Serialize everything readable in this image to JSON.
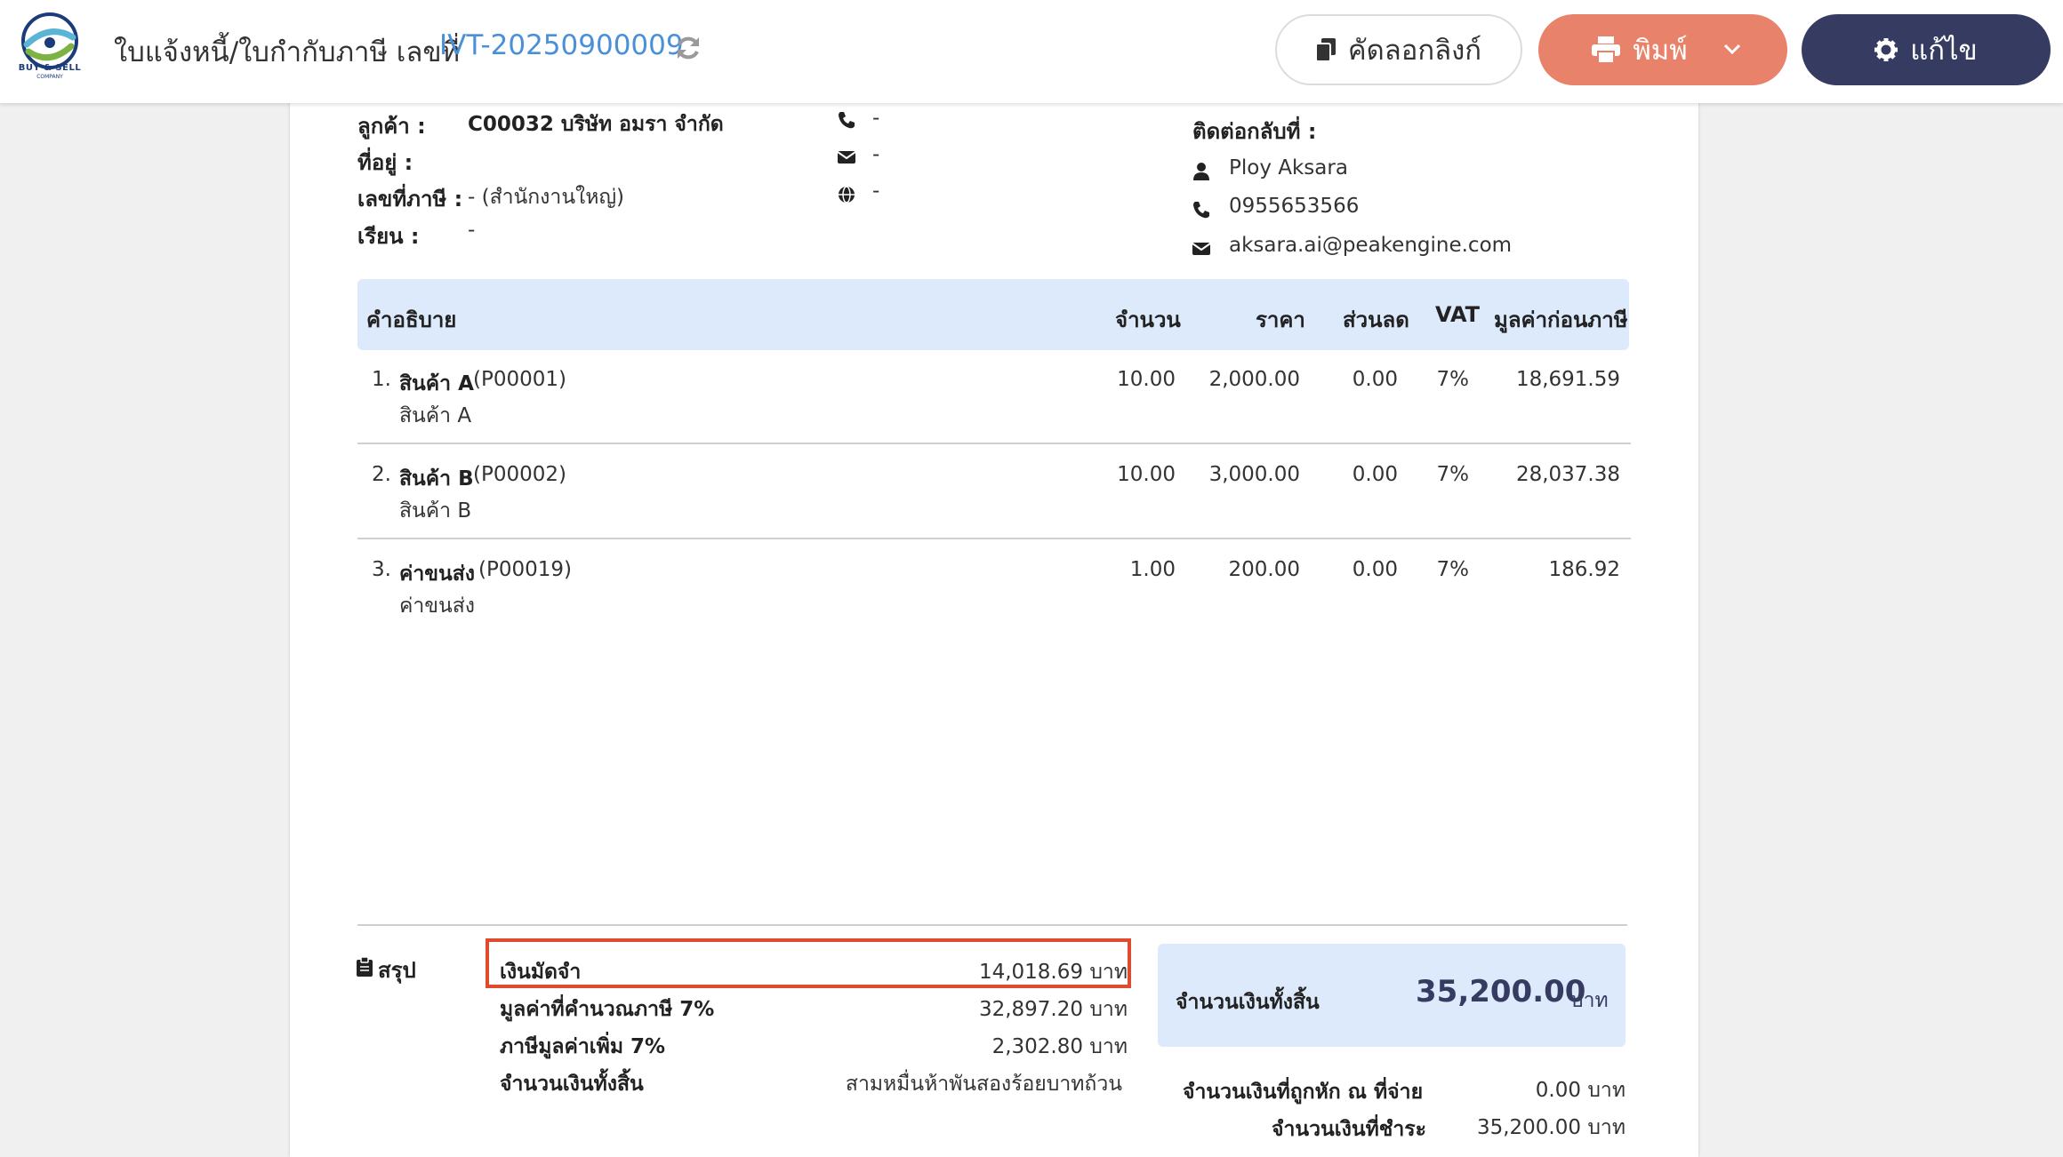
{
  "header": {
    "logo_text": "BUY & SELL",
    "logo_sub": "COMPANY",
    "title": "ใบแจ้งหนี้/ใบกำกับภาษี เลขที่",
    "doc_number": "IVT-20250900009",
    "copy_link_label": "คัดลอกลิงก์",
    "print_label": "พิมพ์",
    "edit_label": "แก้ไข",
    "colors": {
      "link_blue": "#4a90d9",
      "print_orange": "#e9826a",
      "edit_navy": "#363c61",
      "highlight_red": "#e04a2f",
      "table_header_bg": "#ddeafb"
    }
  },
  "customer": {
    "customer_label": "ลูกค้า :",
    "customer_value": "C00032 บริษัท อมรา จำกัด",
    "address_label": "ที่อยู่ :",
    "address_value": "",
    "tax_id_label": "เลขที่ภาษี :",
    "tax_id_value": "- (สำนักงานใหญ่)",
    "attn_label": "เรียน :",
    "attn_value": "-",
    "phone_value": "-",
    "email_value": "-",
    "website_value": "-"
  },
  "contact": {
    "label": "ติดต่อกลับที่ :",
    "name": "Ploy Aksara",
    "phone": "0955653566",
    "email": "aksara.ai@peakengine.com"
  },
  "table": {
    "headers": {
      "description": "คำอธิบาย",
      "quantity": "จำนวน",
      "price": "ราคา",
      "discount": "ส่วนลด",
      "vat": "VAT",
      "pre_tax_value": "มูลค่าก่อนภาษี"
    },
    "rows": [
      {
        "no": "1.",
        "name": "สินค้า A",
        "code": "(P00001)",
        "detail": "สินค้า A",
        "quantity": "10.00",
        "price": "2,000.00",
        "discount": "0.00",
        "vat": "7%",
        "amount": "18,691.59"
      },
      {
        "no": "2.",
        "name": "สินค้า B",
        "code": "(P00002)",
        "detail": "สินค้า B",
        "quantity": "10.00",
        "price": "3,000.00",
        "discount": "0.00",
        "vat": "7%",
        "amount": "28,037.38"
      },
      {
        "no": "3.",
        "name": "ค่าขนส่ง",
        "code": "(P00019)",
        "detail": "ค่าขนส่ง",
        "quantity": "1.00",
        "price": "200.00",
        "discount": "0.00",
        "vat": "7%",
        "amount": "186.92"
      }
    ]
  },
  "summary": {
    "title": "สรุป",
    "deposit_label": "เงินมัดจำ",
    "deposit_value": "14,018.69 บาท",
    "taxable_label": "มูลค่าที่คำนวณภาษี 7%",
    "taxable_value": "32,897.20 บาท",
    "vat_label": "ภาษีมูลค่าเพิ่ม 7%",
    "vat_value": "2,302.80 บาท",
    "total_text_label": "จำนวนเงินทั้งสิ้น",
    "total_text_value": "สามหมื่นห้าพันสองร้อยบาทถ้วน",
    "grand_total_label": "จำนวนเงินทั้งสิ้น",
    "grand_total_amount": "35,200.00",
    "grand_total_unit": "บาท",
    "withholding_label": "จำนวนเงินที่ถูกหัก ณ ที่จ่าย",
    "withholding_value": "0.00 บาท",
    "payable_label": "จำนวนเงินที่ชำระ",
    "payable_value": "35,200.00 บาท"
  }
}
